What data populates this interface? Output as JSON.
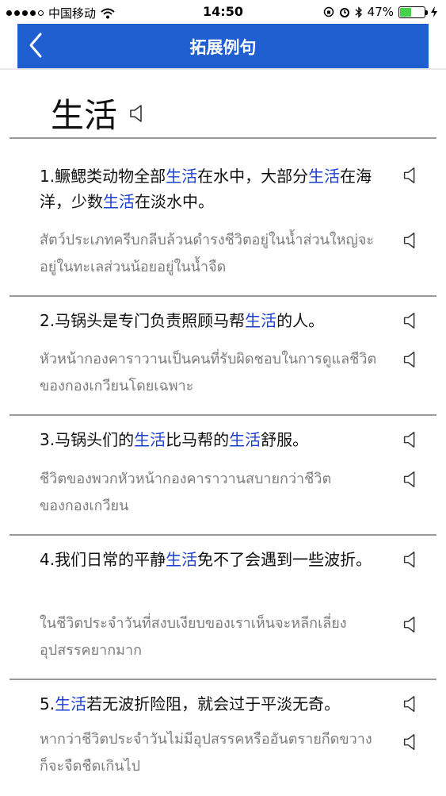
{
  "status_bar": {
    "carrier": "中国移动",
    "time": "14:50",
    "battery_text": "47%",
    "battery_level": 0.47
  },
  "header": {
    "title": "拓展例句"
  },
  "word": "生活",
  "colors": {
    "accent": "#1f5fd0",
    "highlight": "#1c3fd6",
    "translation": "#7c7c7c"
  },
  "examples": [
    {
      "zh_segments": [
        "1.鳜鳃类动物全部",
        "生活",
        "在水中，大部分",
        "生活",
        "在海洋，少数",
        "生活",
        "在淡水中。"
      ],
      "th": "สัตว์ประเภทครีบกลีบล้วนดำรงชีวิตอยู่ในน้ำส่วนใหญ่จะอยู่ในทะเลส่วนน้อยอยู่ในน้ำจืด"
    },
    {
      "zh_segments": [
        "2.马锅头是专门负责照顾马帮",
        "生活",
        "的人。"
      ],
      "th": "หัวหน้ากองคาราวานเป็นคนที่รับผิดชอบในการดูแลชีวิตของกองเกวียนโดยเฉพาะ"
    },
    {
      "zh_segments": [
        "3.马锅头们的",
        "生活",
        "比马帮的",
        "生活",
        "舒服。"
      ],
      "th": "ชีวิตของพวกหัวหน้ากองคาราวานสบายกว่าชีวิตของกองเกวียน"
    },
    {
      "zh_segments": [
        "4.我们日常的平静",
        "生活",
        "免不了会遇到一些波折。"
      ],
      "th": "ในชีวิตประจำวันที่สงบเงียบของเราเห็นจะหลีกเลี่ยงอุปสรรคยากมาก"
    },
    {
      "zh_segments": [
        "5.",
        "生活",
        "若无波折险阻，就会过于平淡无奇。"
      ],
      "th": "หากว่าชีวิตประจำวันไม่มีอุปสรรคหรืออันตรายกีดขวางก็จะจืดชืดเกินไป"
    }
  ]
}
